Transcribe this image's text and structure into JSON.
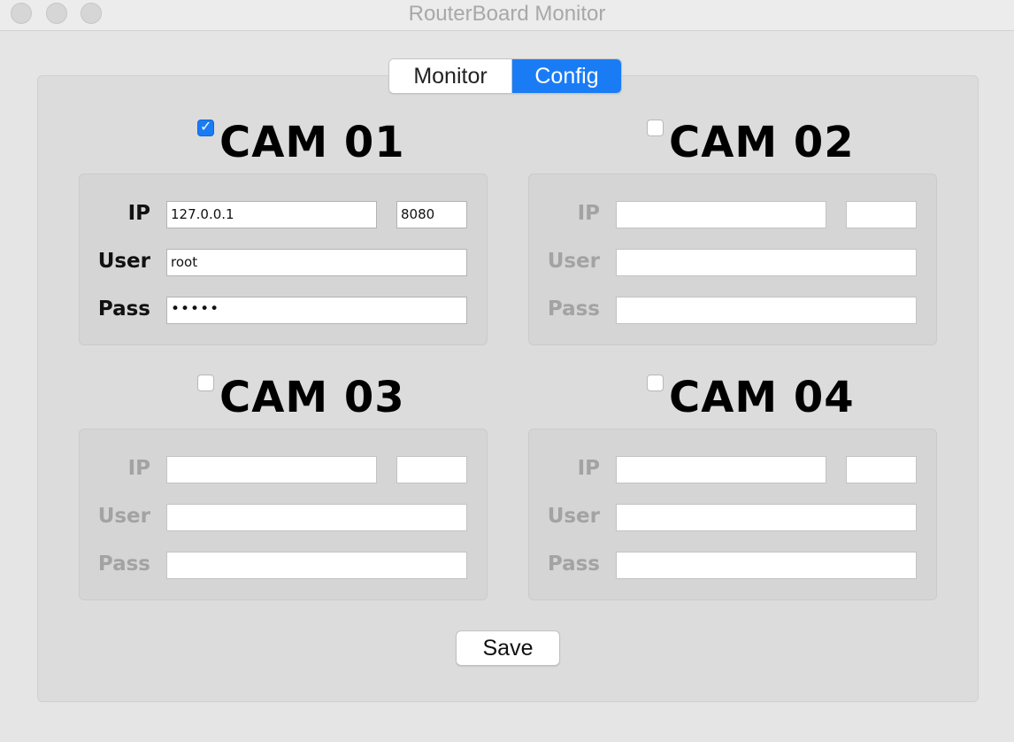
{
  "window": {
    "title": "RouterBoard Monitor"
  },
  "tabs": [
    {
      "label": "Monitor",
      "selected": false
    },
    {
      "label": "Config",
      "selected": true
    }
  ],
  "labels": {
    "ip": "IP",
    "user": "User",
    "pass": "Pass"
  },
  "cameras": [
    {
      "title": "CAM 01",
      "enabled": true,
      "ip": "127.0.0.1",
      "port": "8080",
      "user": "root",
      "pass": "•••••"
    },
    {
      "title": "CAM 02",
      "enabled": false,
      "ip": "",
      "port": "",
      "user": "",
      "pass": ""
    },
    {
      "title": "CAM 03",
      "enabled": false,
      "ip": "",
      "port": "",
      "user": "",
      "pass": ""
    },
    {
      "title": "CAM 04",
      "enabled": false,
      "ip": "",
      "port": "",
      "user": "",
      "pass": ""
    }
  ],
  "actions": {
    "save_label": "Save"
  },
  "colors": {
    "accent": "#1a7cf5",
    "disabled_label": "#a3a3a3"
  }
}
